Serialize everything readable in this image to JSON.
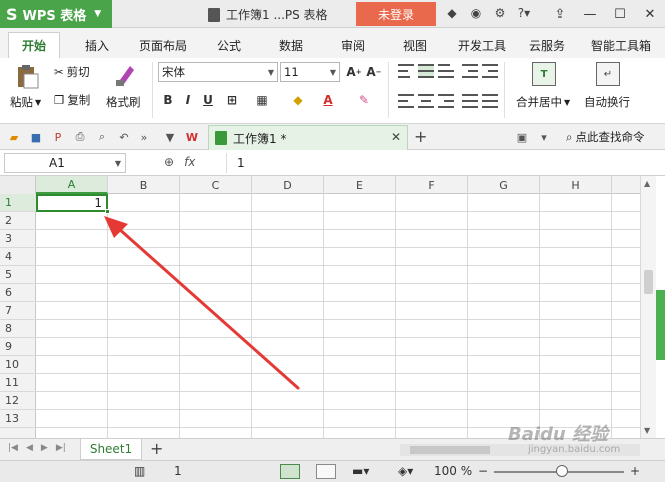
{
  "titlebar": {
    "app_name": "WPS 表格",
    "doc_title": "工作簿1 ...PS 表格",
    "login_label": "未登录"
  },
  "menu": {
    "tabs": [
      "开始",
      "插入",
      "页面布局",
      "公式",
      "数据",
      "审阅",
      "视图",
      "开发工具",
      "云服务",
      "智能工具箱"
    ]
  },
  "ribbon": {
    "paste_label": "粘贴",
    "cut_label": "剪切",
    "copy_label": "复制",
    "format_painter_label": "格式刷",
    "font_name": "宋体",
    "font_size": "11",
    "merge_center_label": "合并居中",
    "wrap_text_label": "自动换行"
  },
  "tabs": {
    "doc_tab_label": "工作簿1 *",
    "search_command": "点此查找命令"
  },
  "formula": {
    "name_box": "A1",
    "fx_label": "fx",
    "value": "1"
  },
  "grid": {
    "columns": [
      "A",
      "B",
      "C",
      "D",
      "E",
      "F",
      "G",
      "H"
    ],
    "rows": [
      "1",
      "2",
      "3",
      "4",
      "5",
      "6",
      "7",
      "8",
      "9",
      "10",
      "11",
      "12",
      "13"
    ],
    "cell_a1": "1"
  },
  "sheets": {
    "active": "Sheet1"
  },
  "status": {
    "page_num": "1",
    "zoom": "100 %"
  },
  "watermark": {
    "brand": "Baidu 经验",
    "url": "jingyan.baidu.com"
  },
  "colors": {
    "brand_green": "#4aa54a",
    "login_orange": "#e9694c",
    "selection_green": "#2e8b2e",
    "arrow_red": "#e53935"
  }
}
